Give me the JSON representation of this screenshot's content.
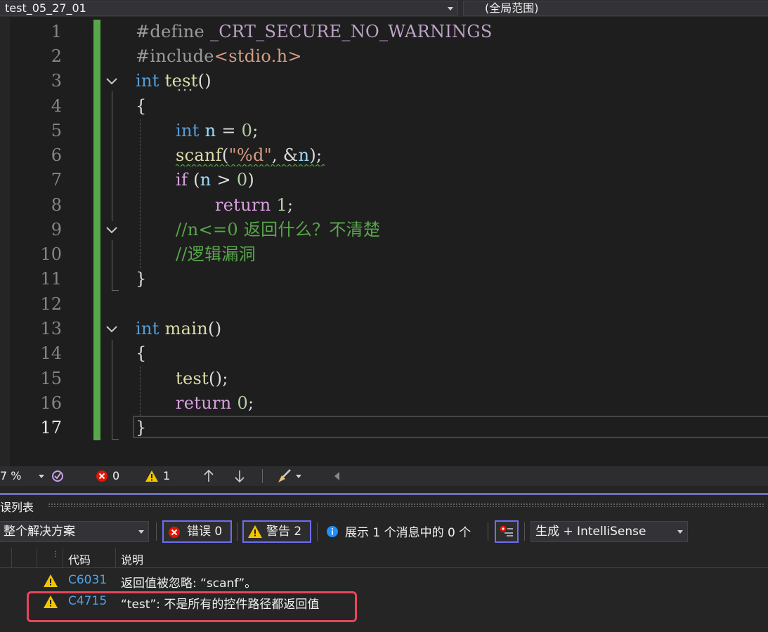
{
  "nav": {
    "project": "test_05_27_01",
    "scope": "(全局范围)"
  },
  "editor": {
    "line_numbers": [
      "1",
      "2",
      "3",
      "4",
      "5",
      "6",
      "7",
      "8",
      "9",
      "10",
      "11",
      "12",
      "13",
      "14",
      "15",
      "16",
      "17"
    ],
    "current_line": "17",
    "lines": {
      "l1_pp": "#define",
      "l1_macro": "_CRT_SECURE_NO_WARNINGS",
      "l2_pp": "#include",
      "l2_hdr": "<stdio.h>",
      "l3_kw": "int",
      "l3_fn": "test",
      "l3_rest": "()",
      "l4": "{",
      "l5_kw": "int",
      "l5_var": "n",
      "l5_op": " = ",
      "l5_num": "0",
      "l5_end": ";",
      "l6_fn": "scanf",
      "l6_p1": "(",
      "l6_str": "\"%d\"",
      "l6_p2": ", &",
      "l6_var": "n",
      "l6_p3": ");",
      "l7_ctl": "if",
      "l7_p1": " (",
      "l7_var": "n",
      "l7_op": " > ",
      "l7_num": "0",
      "l7_p2": ")",
      "l8_ctl": "return",
      "l8_num": "1",
      "l8_end": ";",
      "l9": "//n<=0 返回什么？不清楚",
      "l10": "//逻辑漏洞",
      "l11": "}",
      "l13_kw": "int",
      "l13_fn": "main",
      "l13_rest": "()",
      "l14": "{",
      "l15_fn": "test",
      "l15_rest": "();",
      "l16_ctl": "return",
      "l16_num": "0",
      "l16_end": ";",
      "l17": "}"
    }
  },
  "status": {
    "zoom": "7 %",
    "errors": "0",
    "warnings": "1"
  },
  "error_list": {
    "title": "误列表",
    "scope_select": "整个解决方案",
    "errors_btn": "错误 0",
    "warnings_btn": "警告 2",
    "messages_btn": "展示 1 个消息中的 0 个",
    "source_select": "生成 + IntelliSense",
    "columns": {
      "code": "代码",
      "desc": "说明"
    },
    "rows": [
      {
        "code": "C6031",
        "desc": "返回值被忽略: “scanf”。"
      },
      {
        "code": "C4715",
        "desc": "“test”: 不是所有的控件路径都返回值"
      }
    ]
  },
  "colors": {
    "accent": "#6e6ef0",
    "highlight": "#e8455a",
    "change_bar": "#57a64a"
  }
}
